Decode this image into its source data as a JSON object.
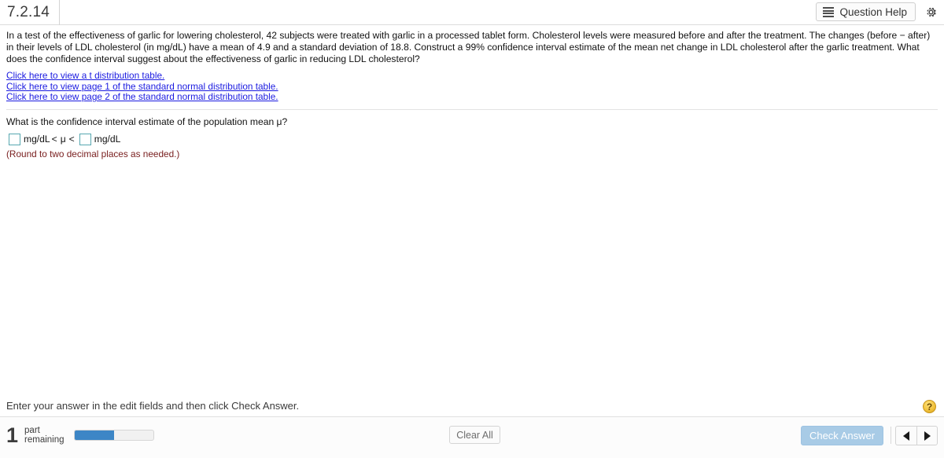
{
  "header": {
    "question_number": "7.2.14",
    "question_help_label": "Question Help",
    "list_icon": "list-icon",
    "gear_icon": "gear-icon"
  },
  "question": {
    "text": "In a test of the effectiveness of garlic for lowering cholesterol, 42 subjects were treated with garlic in a processed tablet form. Cholesterol levels were measured before and after the treatment. The changes (before − after) in their levels of LDL cholesterol (in mg/dL) have a mean of 4.9 and a standard deviation of 18.8. Construct a 99% confidence interval estimate of the mean net change in LDL cholesterol after the garlic treatment. What does the confidence interval suggest about the effectiveness of garlic in reducing LDL cholesterol?",
    "links": [
      "Click here to view a t distribution table.",
      "Click here to view page 1 of the standard normal distribution table.",
      "Click here to view page 2 of the standard normal distribution table."
    ]
  },
  "answer": {
    "prompt": "What is the confidence interval estimate of the population mean μ?",
    "lower_value": "",
    "lower_placeholder": "",
    "upper_value": "",
    "upper_placeholder": "",
    "unit_left": "mg/dL",
    "unit_right": "mg/dL",
    "inequality_left": "<",
    "mu_symbol": "μ",
    "inequality_right": "<",
    "round_note": "(Round to two decimal places as needed.)"
  },
  "footer": {
    "hint": "Enter your answer in the edit fields and then click Check Answer.",
    "help_badge": "?",
    "parts_remaining_count": "1",
    "parts_label_line1": "part",
    "parts_label_line2": "remaining",
    "progress_percent": 50,
    "clear_all_label": "Clear All",
    "check_answer_label": "Check Answer",
    "prev_icon": "triangle-left-icon",
    "next_icon": "triangle-right-icon"
  },
  "colors": {
    "link": "#1a1ae0",
    "input_border": "#56a7b0",
    "round_note": "#7a2020",
    "progress_fill": "#3d86c6",
    "check_button_bg": "#a8cbe6",
    "help_badge_bg": "#f0c03a"
  }
}
